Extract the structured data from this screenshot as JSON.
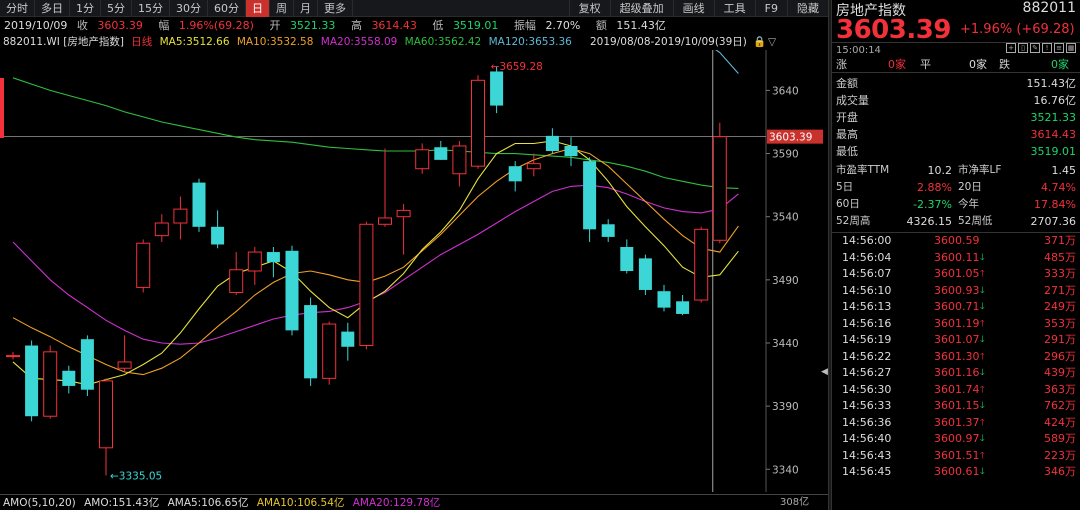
{
  "toolbar": {
    "left": [
      "分时",
      "多日",
      "1分",
      "5分",
      "15分",
      "30分",
      "60分",
      "日",
      "周",
      "月",
      "更多"
    ],
    "active_index": 7,
    "right": [
      "复权",
      "超级叠加",
      "画线",
      "工具",
      "F9",
      "隐藏"
    ]
  },
  "info": {
    "date": "2019/10/09",
    "close_label": "收",
    "close": "3603.39",
    "amp_label": "幅",
    "amp": "1.96%(69.28)",
    "open_label": "开",
    "open": "3521.33",
    "high_label": "高",
    "high": "3614.43",
    "low_label": "低",
    "low": "3519.01",
    "swing_label": "振幅",
    "swing": "2.70%",
    "amount_label": "额",
    "amount": "151.43亿"
  },
  "ma": {
    "code": "882011.WI [房地产指数]",
    "period": "日线",
    "ma5": "MA5:3512.66",
    "ma10": "MA10:3532.58",
    "ma20": "MA20:3558.09",
    "ma60": "MA60:3562.42",
    "ma120": "MA120:3653.36",
    "range": "2019/08/08-2019/10/09(39日)"
  },
  "vol": {
    "title": "AMO(5,10,20)",
    "amo": "AMO:151.43亿",
    "ama5": "AMA5:106.65亿",
    "ama10": "AMA10:106.54亿",
    "ama20": "AMA20:129.78亿"
  },
  "colors": {
    "up": "#f2313a",
    "down": "#3dd6d6",
    "ma5": "#e6e23a",
    "ma10": "#f0a028",
    "ma20": "#d030d0",
    "ma60": "#2fbf3f",
    "ma120": "#5fb8d8",
    "label_bg": "#c8312c"
  },
  "chart_data": {
    "type": "candlestick",
    "candles": [
      {
        "o": 3430,
        "h": 3433,
        "l": 3427,
        "c": 3430
      },
      {
        "o": 3438,
        "h": 3442,
        "l": 3378,
        "c": 3382
      },
      {
        "o": 3382,
        "h": 3438,
        "l": 3380,
        "c": 3433
      },
      {
        "o": 3418,
        "h": 3422,
        "l": 3400,
        "c": 3406
      },
      {
        "o": 3443,
        "h": 3446,
        "l": 3398,
        "c": 3403
      },
      {
        "o": 3357,
        "h": 3412,
        "l": 3335.05,
        "c": 3410
      },
      {
        "o": 3420,
        "h": 3446,
        "l": 3417,
        "c": 3425
      },
      {
        "o": 3484,
        "h": 3522,
        "l": 3480,
        "c": 3519
      },
      {
        "o": 3525,
        "h": 3542,
        "l": 3520,
        "c": 3535
      },
      {
        "o": 3535,
        "h": 3556,
        "l": 3522,
        "c": 3546
      },
      {
        "o": 3567,
        "h": 3570,
        "l": 3528,
        "c": 3532
      },
      {
        "o": 3532,
        "h": 3545,
        "l": 3515,
        "c": 3518
      },
      {
        "o": 3480,
        "h": 3512,
        "l": 3478,
        "c": 3498
      },
      {
        "o": 3497,
        "h": 3516,
        "l": 3486,
        "c": 3512
      },
      {
        "o": 3512,
        "h": 3516,
        "l": 3492,
        "c": 3504
      },
      {
        "o": 3513,
        "h": 3517,
        "l": 3446,
        "c": 3450
      },
      {
        "o": 3470,
        "h": 3476,
        "l": 3406,
        "c": 3412
      },
      {
        "o": 3412,
        "h": 3457,
        "l": 3407,
        "c": 3455
      },
      {
        "o": 3449,
        "h": 3456,
        "l": 3426,
        "c": 3437
      },
      {
        "o": 3438,
        "h": 3536,
        "l": 3435,
        "c": 3534
      },
      {
        "o": 3534,
        "h": 3594,
        "l": 3532,
        "c": 3539
      },
      {
        "o": 3540,
        "h": 3550,
        "l": 3510,
        "c": 3545
      },
      {
        "o": 3578,
        "h": 3598,
        "l": 3574,
        "c": 3593
      },
      {
        "o": 3595,
        "h": 3600,
        "l": 3585,
        "c": 3585
      },
      {
        "o": 3574,
        "h": 3600,
        "l": 3564,
        "c": 3596
      },
      {
        "o": 3580,
        "h": 3652,
        "l": 3578,
        "c": 3648
      },
      {
        "o": 3655,
        "h": 3659.28,
        "l": 3622,
        "c": 3628
      },
      {
        "o": 3580,
        "h": 3584,
        "l": 3560,
        "c": 3568
      },
      {
        "o": 3578,
        "h": 3590,
        "l": 3572,
        "c": 3582
      },
      {
        "o": 3604,
        "h": 3610,
        "l": 3590,
        "c": 3592
      },
      {
        "o": 3596,
        "h": 3603,
        "l": 3580,
        "c": 3588
      },
      {
        "o": 3584,
        "h": 3587,
        "l": 3520,
        "c": 3530
      },
      {
        "o": 3534,
        "h": 3538,
        "l": 3520,
        "c": 3524
      },
      {
        "o": 3516,
        "h": 3522,
        "l": 3495,
        "c": 3497
      },
      {
        "o": 3507,
        "h": 3510,
        "l": 3478,
        "c": 3482
      },
      {
        "o": 3481,
        "h": 3486,
        "l": 3465,
        "c": 3468
      },
      {
        "o": 3473,
        "h": 3478,
        "l": 3462,
        "c": 3463
      },
      {
        "o": 3474,
        "h": 3532,
        "l": 3472,
        "c": 3530
      },
      {
        "o": 3521.33,
        "h": 3614.43,
        "l": 3519.01,
        "c": 3603.39
      }
    ],
    "ma5": [
      3425,
      3412,
      3411,
      3410,
      3407,
      3411,
      3415,
      3423,
      3432,
      3448,
      3467,
      3485,
      3495,
      3500,
      3505,
      3496,
      3481,
      3468,
      3460,
      3472,
      3481,
      3495,
      3514,
      3528,
      3545,
      3570,
      3590,
      3598,
      3598,
      3600,
      3596,
      3585,
      3568,
      3548,
      3532,
      3517,
      3500,
      3492,
      3494,
      3512.66
    ],
    "ma10": [
      3460,
      3452,
      3445,
      3437,
      3430,
      3423,
      3417,
      3415,
      3420,
      3428,
      3440,
      3453,
      3465,
      3478,
      3488,
      3495,
      3497,
      3494,
      3490,
      3488,
      3493,
      3500,
      3513,
      3526,
      3541,
      3556,
      3568,
      3578,
      3585,
      3590,
      3594,
      3590,
      3580,
      3566,
      3552,
      3538,
      3525,
      3515,
      3512,
      3532.58
    ],
    "ma20": [
      3520,
      3505,
      3490,
      3478,
      3468,
      3458,
      3450,
      3443,
      3440,
      3439,
      3440,
      3444,
      3449,
      3454,
      3459,
      3462,
      3464,
      3465,
      3468,
      3473,
      3480,
      3490,
      3500,
      3510,
      3518,
      3526,
      3535,
      3544,
      3552,
      3560,
      3564,
      3565,
      3563,
      3558,
      3552,
      3547,
      3544,
      3543,
      3546,
      3558.09
    ],
    "ma60": [
      3650,
      3645,
      3640,
      3636,
      3632,
      3628,
      3623,
      3619,
      3615,
      3612,
      3609,
      3606,
      3603,
      3601,
      3600,
      3599,
      3597,
      3595,
      3594,
      3593,
      3592,
      3592,
      3592,
      3593,
      3592,
      3591,
      3590,
      3590,
      3589,
      3588,
      3587,
      3585,
      3583,
      3580,
      3576,
      3571,
      3568,
      3565,
      3563,
      3562.42
    ],
    "ma120": [
      null,
      null,
      null,
      null,
      null,
      null,
      null,
      null,
      null,
      null,
      null,
      null,
      null,
      null,
      null,
      null,
      null,
      null,
      null,
      null,
      null,
      null,
      null,
      null,
      null,
      null,
      null,
      null,
      null,
      null,
      null,
      null,
      null,
      null,
      null,
      null,
      3690,
      3680,
      3670,
      3653.36
    ],
    "y_ticks": [
      3640,
      3590,
      3540,
      3490,
      3440,
      3390,
      3340
    ],
    "ylim": [
      3322,
      3672
    ],
    "high_label": "3659.28",
    "low_label": "←3335.05",
    "last_label": "3603.39",
    "vol_tick": "308亿"
  },
  "panel": {
    "name": "房地产指数",
    "code": "882011",
    "price": "3603.39",
    "change": "+1.96% (+69.28)",
    "time": "15:00:14",
    "flat": {
      "up_label": "涨",
      "up": "0家",
      "flat_label": "平",
      "flat": "0家",
      "down_label": "跌",
      "down": "0家"
    },
    "stats": [
      {
        "k": "金额",
        "v": "151.43亿",
        "color": "white"
      },
      {
        "k": "成交量",
        "v": "16.76亿",
        "color": "white"
      },
      {
        "k": "开盘",
        "v": "3521.33",
        "color": "green"
      },
      {
        "k": "最高",
        "v": "3614.43",
        "color": "red"
      },
      {
        "k": "最低",
        "v": "3519.01",
        "color": "green"
      }
    ],
    "grid": [
      {
        "k1": "市盈率TTM",
        "v1": "10.2",
        "c1": "white",
        "k2": "市净率LF",
        "v2": "1.45",
        "c2": "white"
      },
      {
        "k1": "5日",
        "v1": "2.88%",
        "c1": "red",
        "k2": "20日",
        "v2": "4.74%",
        "c2": "red"
      },
      {
        "k1": "60日",
        "v1": "-2.37%",
        "c1": "green",
        "k2": "今年",
        "v2": "17.84%",
        "c2": "red"
      },
      {
        "k1": "52周高",
        "v1": "4326.15",
        "c1": "white",
        "k2": "52周低",
        "v2": "2707.36",
        "c2": "white"
      }
    ],
    "ticks": [
      {
        "time": "14:56:00",
        "price": "3600.59",
        "dir": "",
        "vol": "371万"
      },
      {
        "time": "14:56:04",
        "price": "3600.11",
        "dir": "down",
        "vol": "485万"
      },
      {
        "time": "14:56:07",
        "price": "3601.05",
        "dir": "up",
        "vol": "333万"
      },
      {
        "time": "14:56:10",
        "price": "3600.93",
        "dir": "down",
        "vol": "271万"
      },
      {
        "time": "14:56:13",
        "price": "3600.71",
        "dir": "down",
        "vol": "249万"
      },
      {
        "time": "14:56:16",
        "price": "3601.19",
        "dir": "up",
        "vol": "353万"
      },
      {
        "time": "14:56:19",
        "price": "3601.07",
        "dir": "down",
        "vol": "291万"
      },
      {
        "time": "14:56:22",
        "price": "3601.30",
        "dir": "up",
        "vol": "296万"
      },
      {
        "time": "14:56:27",
        "price": "3601.16",
        "dir": "down",
        "vol": "439万"
      },
      {
        "time": "14:56:30",
        "price": "3601.74",
        "dir": "up",
        "vol": "363万"
      },
      {
        "time": "14:56:33",
        "price": "3601.15",
        "dir": "down",
        "vol": "762万"
      },
      {
        "time": "14:56:36",
        "price": "3601.37",
        "dir": "up",
        "vol": "424万"
      },
      {
        "time": "14:56:40",
        "price": "3600.97",
        "dir": "down",
        "vol": "589万"
      },
      {
        "time": "14:56:43",
        "price": "3601.51",
        "dir": "up",
        "vol": "223万"
      },
      {
        "time": "14:56:45",
        "price": "3600.61",
        "dir": "down",
        "vol": "346万"
      }
    ]
  }
}
